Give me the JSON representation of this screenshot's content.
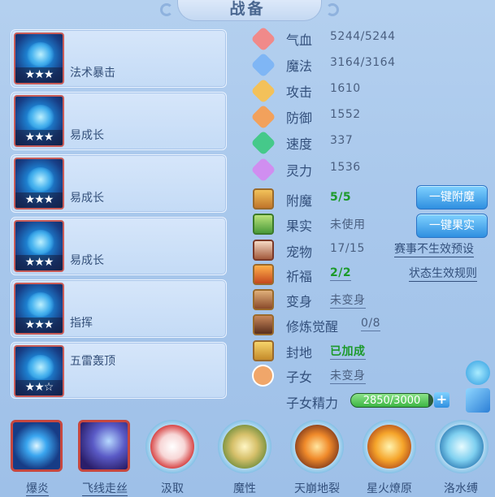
{
  "title": "战备",
  "skills": [
    {
      "name": "法术暴击",
      "stars": "★★★"
    },
    {
      "name": "易成长",
      "stars": "★★★"
    },
    {
      "name": "易成长",
      "stars": "★★★"
    },
    {
      "name": "易成长",
      "stars": "★★★"
    },
    {
      "name": "指挥",
      "stars": "★★★"
    },
    {
      "name": "五雷轰顶",
      "stars": "★★☆"
    }
  ],
  "stats": [
    {
      "label": "气血",
      "value": "5244/5244",
      "icon": "heart-icon",
      "color": "#f08a8a"
    },
    {
      "label": "魔法",
      "value": "3164/3164",
      "icon": "shield-icon",
      "color": "#7fb6f5"
    },
    {
      "label": "攻击",
      "value": "1610",
      "icon": "sword-icon",
      "color": "#f3c15a"
    },
    {
      "label": "防御",
      "value": "1552",
      "icon": "armor-icon",
      "color": "#f2a15c"
    },
    {
      "label": "速度",
      "value": "337",
      "icon": "lightning-icon",
      "color": "#45c98a"
    },
    {
      "label": "灵力",
      "value": "1536",
      "icon": "spirit-icon",
      "color": "#d08ef0"
    }
  ],
  "status": {
    "enchant_label": "附魔",
    "enchant_value": "5/5",
    "fruit_label": "果实",
    "fruit_value": "未使用",
    "pet_label": "宠物",
    "pet_value": "17/15",
    "pray_label": "祈福",
    "pray_value": "2/2",
    "transform_label": "变身",
    "transform_value": "未变身",
    "cultivate_label": "修炼觉醒",
    "cultivate_value": "0/8",
    "fief_label": "封地",
    "fief_value": "已加成",
    "child_label": "子女",
    "child_value": "未变身",
    "child_energy_label": "子女精力",
    "child_energy_value": "2850/3000",
    "child_energy_fraction": 0.95
  },
  "buttons": {
    "one_click_enchant": "一键附魔",
    "one_click_fruit": "一键果实",
    "event_preset": "赛事不生效预设",
    "state_rules": "状态生效规则",
    "plus": "+"
  },
  "bottom_skills": [
    "爆炎",
    "飞线走丝",
    "汲取",
    "魔性",
    "天崩地裂",
    "星火燎原",
    "洛水缚"
  ]
}
